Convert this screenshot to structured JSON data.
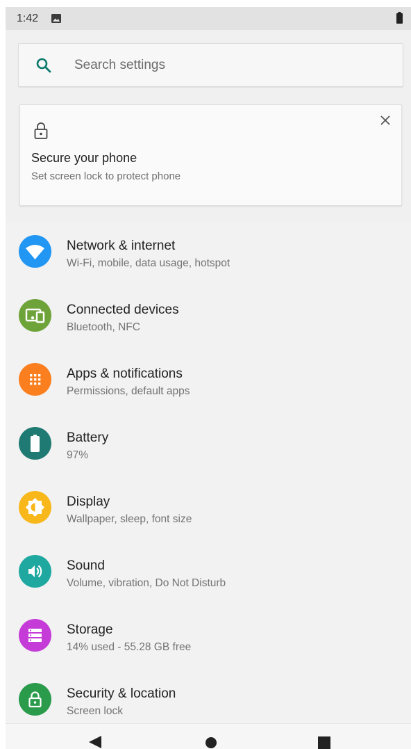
{
  "status_bar": {
    "time": "1:42"
  },
  "search": {
    "placeholder": "Search settings"
  },
  "suggestion": {
    "title": "Secure your phone",
    "subtitle": "Set screen lock to protect phone"
  },
  "settings": [
    {
      "title": "Network & internet",
      "subtitle": "Wi-Fi, mobile, data usage, hotspot",
      "icon": "wifi-icon",
      "color": "#2196f3"
    },
    {
      "title": "Connected devices",
      "subtitle": "Bluetooth, NFC",
      "icon": "devices-icon",
      "color": "#6ea33a"
    },
    {
      "title": "Apps & notifications",
      "subtitle": "Permissions, default apps",
      "icon": "apps-grid-icon",
      "color": "#fb7f1e"
    },
    {
      "title": "Battery",
      "subtitle": "97%",
      "icon": "battery-icon",
      "color": "#1e7a72"
    },
    {
      "title": "Display",
      "subtitle": "Wallpaper, sleep, font size",
      "icon": "brightness-icon",
      "color": "#f8b81b"
    },
    {
      "title": "Sound",
      "subtitle": "Volume, vibration, Do Not Disturb",
      "icon": "volume-icon",
      "color": "#1fa8a0"
    },
    {
      "title": "Storage",
      "subtitle": "14% used - 55.28 GB free",
      "icon": "storage-icon",
      "color": "#c53bd8"
    },
    {
      "title": "Security & location",
      "subtitle": "Screen lock",
      "icon": "lock-icon",
      "color": "#2a9a4b"
    }
  ],
  "colors": {
    "search_icon": "#0c7a6e",
    "background": "#f2f2f2"
  }
}
